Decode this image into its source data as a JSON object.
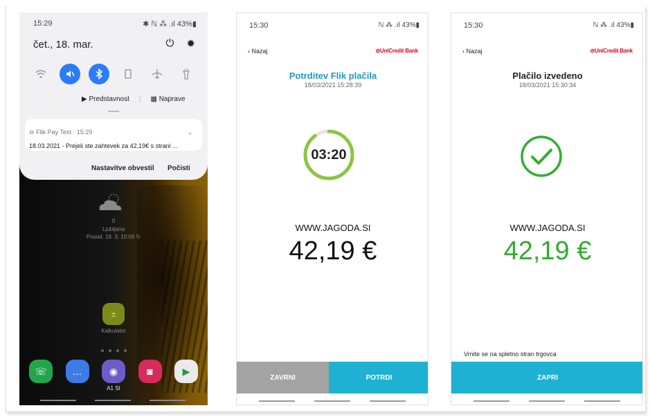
{
  "phone1": {
    "time": "15:29",
    "status": "✱ ℕ ⁂ .ıl 43%▮",
    "date": "čet., 18. mar.",
    "quick_settings": [
      "wifi-icon",
      "mute-icon",
      "bluetooth-icon",
      "rotate-icon",
      "airplane-icon",
      "flashlight-icon"
    ],
    "media_output": "Predstavnost",
    "devices": "Naprave",
    "notification": {
      "app": "Flik Pay Test · 15:29",
      "text": "18.03.2021 - Prejeli ste zahtevek za 42,19€ s strani ...",
      "settings_action": "Nastavitve obvestil",
      "clear_action": "Počisti"
    },
    "weather_temp": "0",
    "weather_location": "Ljubljana",
    "weather_updated": "Posod. 18. 3. 10:09 ↻",
    "calculator_label": "Kalkulator",
    "dock_label": "A1 SI"
  },
  "phone2": {
    "time": "15:30",
    "status": "ℕ ⁂ .ıl 43%▮",
    "back": "‹ Nazaj",
    "bank": "UniCredit Bank",
    "title": "Potrditev Flik plačila",
    "timestamp": "18/03/2021 15:28:39",
    "timer": "03:20",
    "timer_remaining_fraction": 0.9,
    "merchant": "WWW.JAGODA.SI",
    "amount": "42,19 €",
    "btn_finish": "ZAVRNI",
    "btn_confirm": "POTRDI"
  },
  "phone3": {
    "time": "15:30",
    "status": "ℕ ⁂ .ıl 43%▮",
    "back": "‹ Nazaj",
    "bank": "UniCredit Bank",
    "title": "Plačilo izvedeno",
    "timestamp": "18/03/2021 15:30:34",
    "merchant": "WWW.JAGODA.SI",
    "amount": "42,19 €",
    "return_message": "Vrnite se na spletno stran trgovca",
    "btn_close": "ZAPRI"
  },
  "colors": {
    "accent_blue": "#2196c9",
    "button_cyan": "#1fb1d3",
    "button_gray": "#a3a3a3",
    "success_green": "#2fae2f",
    "timer_green": "#8cc63f",
    "unicredit_red": "#e2001a"
  }
}
